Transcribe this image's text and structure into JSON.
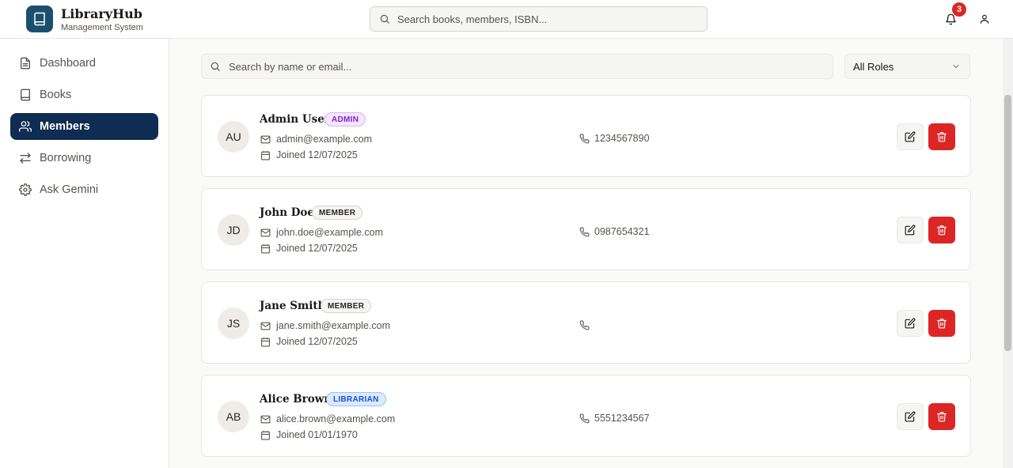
{
  "app": {
    "title": "LibraryHub",
    "subtitle": "Management System",
    "logo_icon": "book-icon",
    "brand_color": "#1b4f6e"
  },
  "header": {
    "search_placeholder": "Search books, members, ISBN...",
    "notification_count": "3",
    "notification_icon": "bell-icon",
    "user_icon": "user-icon"
  },
  "sidebar": {
    "active_color": "#0f2d52",
    "items": [
      {
        "label": "Dashboard",
        "icon": "file-text-icon",
        "active": false
      },
      {
        "label": "Books",
        "icon": "book-icon",
        "active": false
      },
      {
        "label": "Members",
        "icon": "users-icon",
        "active": true
      },
      {
        "label": "Borrowing",
        "icon": "arrows-swap-icon",
        "active": false
      },
      {
        "label": "Ask Gemini",
        "icon": "gear-icon",
        "active": false
      }
    ]
  },
  "filters": {
    "search_placeholder": "Search by name or email...",
    "role_selected": "All Roles"
  },
  "members": [
    {
      "initials": "AU",
      "name": "Admin User",
      "role": "ADMIN",
      "email": "admin@example.com",
      "joined": "Joined 12/07/2025",
      "phone": "1234567890"
    },
    {
      "initials": "JD",
      "name": "John Doe",
      "role": "MEMBER",
      "email": "john.doe@example.com",
      "joined": "Joined 12/07/2025",
      "phone": "0987654321"
    },
    {
      "initials": "JS",
      "name": "Jane Smith",
      "role": "MEMBER",
      "email": "jane.smith@example.com",
      "joined": "Joined 12/07/2025",
      "phone": ""
    },
    {
      "initials": "AB",
      "name": "Alice Brown",
      "role": "LIBRARIAN",
      "email": "alice.brown@example.com",
      "joined": "Joined 01/01/1970",
      "phone": "5551234567"
    }
  ],
  "colors": {
    "admin_badge": "#7e22ce",
    "member_badge": "#292524",
    "librarian_badge": "#1d4ed8",
    "delete_button": "#dc2626"
  }
}
